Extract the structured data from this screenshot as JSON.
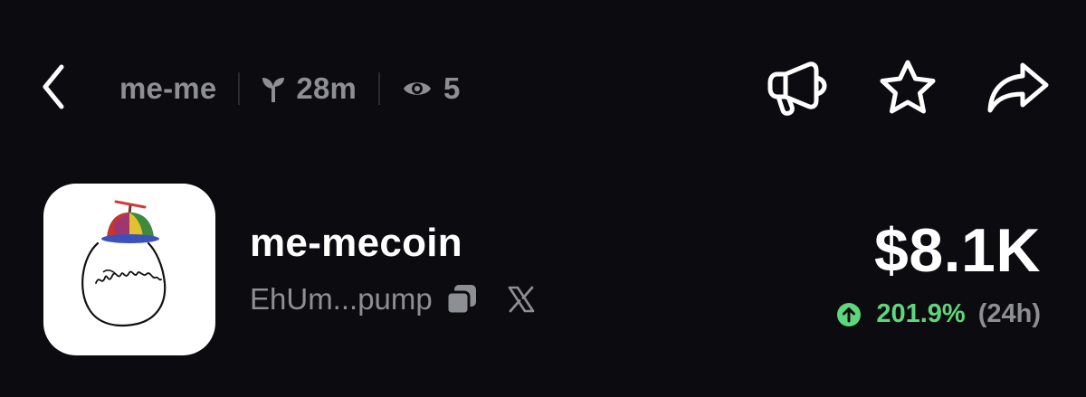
{
  "header": {
    "ticker": "me-me",
    "age": "28m",
    "viewers": "5",
    "icons": {
      "back": "chevron-left-icon",
      "age": "sprout-icon",
      "viewers": "eye-icon",
      "promote": "megaphone-icon",
      "favorite": "star-icon",
      "share": "share-arrow-icon"
    }
  },
  "token": {
    "name": "me-mecoin",
    "address": "EhUm...pump",
    "price": "$8.1K",
    "change_pct": "201.9%",
    "change_period": "(24h)",
    "change_direction": "up",
    "icons": {
      "avatar": "propeller-hat-egg-drawing",
      "copy": "copy-icon",
      "social": "x-logo-icon",
      "change": "arrow-up-circle-icon"
    }
  },
  "colors": {
    "background": "#0c0b0f",
    "text_primary": "#ffffff",
    "text_muted": "#8e8e95",
    "positive": "#5ed67c"
  }
}
